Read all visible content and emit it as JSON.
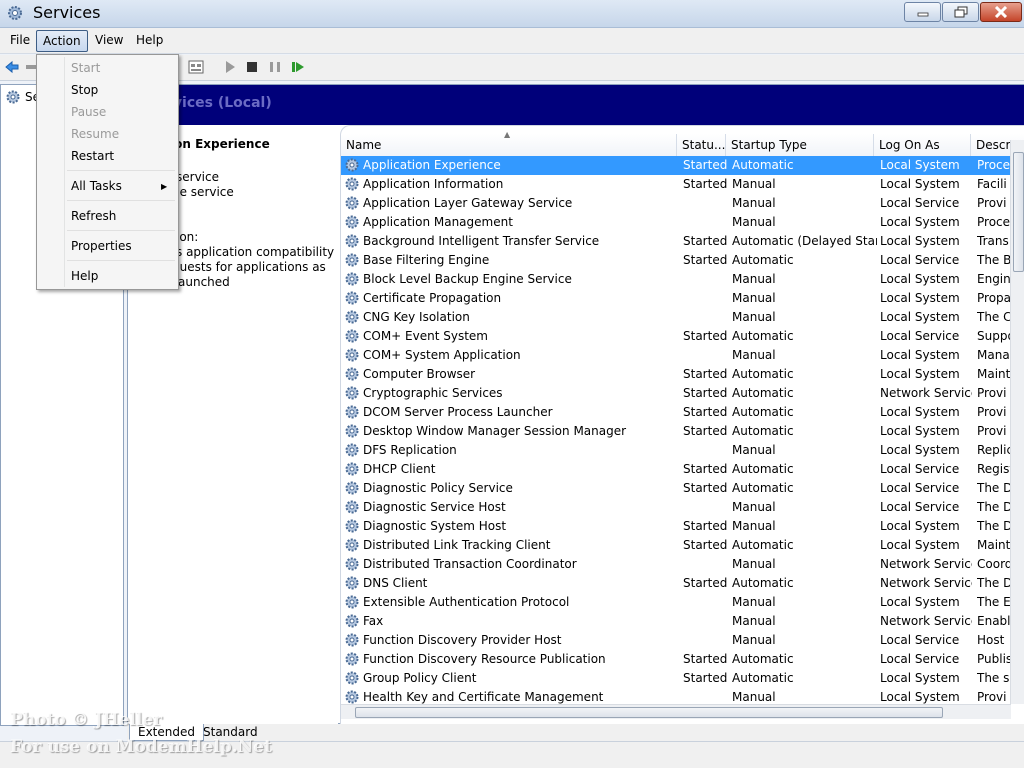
{
  "window": {
    "title": "Services"
  },
  "menubar": {
    "items": [
      "File",
      "Action",
      "View",
      "Help"
    ]
  },
  "tree": {
    "root_label": "Se"
  },
  "header": {
    "title": "rvices (Local)"
  },
  "description": {
    "service_name": "ion Experience",
    "lines": [
      "service",
      "he service",
      "ion:",
      "s application compatibility",
      "quests for applications as",
      "aunched"
    ]
  },
  "columns": [
    "Name",
    "Statu...",
    "Startup Type",
    "Log On As",
    "Descr"
  ],
  "services": [
    {
      "name": "Application Experience",
      "status": "Started",
      "startup": "Automatic",
      "logon": "Local System",
      "desc": "Proce"
    },
    {
      "name": "Application Information",
      "status": "Started",
      "startup": "Manual",
      "logon": "Local System",
      "desc": "Facili"
    },
    {
      "name": "Application Layer Gateway Service",
      "status": "",
      "startup": "Manual",
      "logon": "Local Service",
      "desc": "Provi"
    },
    {
      "name": "Application Management",
      "status": "",
      "startup": "Manual",
      "logon": "Local System",
      "desc": "Proce"
    },
    {
      "name": "Background Intelligent Transfer Service",
      "status": "Started",
      "startup": "Automatic (Delayed Start)",
      "logon": "Local System",
      "desc": "Trans"
    },
    {
      "name": "Base Filtering Engine",
      "status": "Started",
      "startup": "Automatic",
      "logon": "Local Service",
      "desc": "The B"
    },
    {
      "name": "Block Level Backup Engine Service",
      "status": "",
      "startup": "Manual",
      "logon": "Local System",
      "desc": "Engin"
    },
    {
      "name": "Certificate Propagation",
      "status": "",
      "startup": "Manual",
      "logon": "Local System",
      "desc": "Propa"
    },
    {
      "name": "CNG Key Isolation",
      "status": "",
      "startup": "Manual",
      "logon": "Local System",
      "desc": "The C"
    },
    {
      "name": "COM+ Event System",
      "status": "Started",
      "startup": "Automatic",
      "logon": "Local Service",
      "desc": "Suppo"
    },
    {
      "name": "COM+ System Application",
      "status": "",
      "startup": "Manual",
      "logon": "Local System",
      "desc": "Mana"
    },
    {
      "name": "Computer Browser",
      "status": "Started",
      "startup": "Automatic",
      "logon": "Local System",
      "desc": "Maint"
    },
    {
      "name": "Cryptographic Services",
      "status": "Started",
      "startup": "Automatic",
      "logon": "Network Service",
      "desc": "Provi"
    },
    {
      "name": "DCOM Server Process Launcher",
      "status": "Started",
      "startup": "Automatic",
      "logon": "Local System",
      "desc": "Provi"
    },
    {
      "name": "Desktop Window Manager Session Manager",
      "status": "Started",
      "startup": "Automatic",
      "logon": "Local System",
      "desc": "Provi"
    },
    {
      "name": "DFS Replication",
      "status": "",
      "startup": "Manual",
      "logon": "Local System",
      "desc": "Replic"
    },
    {
      "name": "DHCP Client",
      "status": "Started",
      "startup": "Automatic",
      "logon": "Local Service",
      "desc": "Regist"
    },
    {
      "name": "Diagnostic Policy Service",
      "status": "Started",
      "startup": "Automatic",
      "logon": "Local Service",
      "desc": "The D"
    },
    {
      "name": "Diagnostic Service Host",
      "status": "",
      "startup": "Manual",
      "logon": "Local Service",
      "desc": "The D"
    },
    {
      "name": "Diagnostic System Host",
      "status": "Started",
      "startup": "Manual",
      "logon": "Local System",
      "desc": "The D"
    },
    {
      "name": "Distributed Link Tracking Client",
      "status": "Started",
      "startup": "Automatic",
      "logon": "Local System",
      "desc": "Maint"
    },
    {
      "name": "Distributed Transaction Coordinator",
      "status": "",
      "startup": "Manual",
      "logon": "Network Service",
      "desc": "Coord"
    },
    {
      "name": "DNS Client",
      "status": "Started",
      "startup": "Automatic",
      "logon": "Network Service",
      "desc": "The D"
    },
    {
      "name": "Extensible Authentication Protocol",
      "status": "",
      "startup": "Manual",
      "logon": "Local System",
      "desc": "The E"
    },
    {
      "name": "Fax",
      "status": "",
      "startup": "Manual",
      "logon": "Network Service",
      "desc": "Enabl"
    },
    {
      "name": "Function Discovery Provider Host",
      "status": "",
      "startup": "Manual",
      "logon": "Local Service",
      "desc": "Host"
    },
    {
      "name": "Function Discovery Resource Publication",
      "status": "Started",
      "startup": "Automatic",
      "logon": "Local Service",
      "desc": "Publis"
    },
    {
      "name": "Group Policy Client",
      "status": "Started",
      "startup": "Automatic",
      "logon": "Local System",
      "desc": "The s"
    },
    {
      "name": "Health Key and Certificate Management",
      "status": "",
      "startup": "Manual",
      "logon": "Local System",
      "desc": "Provi"
    }
  ],
  "action_menu": {
    "items": [
      {
        "label": "Start",
        "disabled": true
      },
      {
        "label": "Stop",
        "disabled": false
      },
      {
        "label": "Pause",
        "disabled": true
      },
      {
        "label": "Resume",
        "disabled": true
      },
      {
        "label": "Restart",
        "disabled": false
      },
      {
        "label": "All Tasks",
        "disabled": false
      },
      {
        "label": "Refresh",
        "disabled": false
      },
      {
        "label": "Properties",
        "disabled": false
      },
      {
        "label": "Help",
        "disabled": false
      }
    ]
  },
  "tabs": [
    "Extended",
    "Standard"
  ],
  "watermark": {
    "line1": "Photo © JHeller",
    "line2": "For use on ModemHelp.Net"
  },
  "colors": {
    "selection": "#3399ff",
    "header_band": "#00007a",
    "close_button": "#c4452a"
  }
}
